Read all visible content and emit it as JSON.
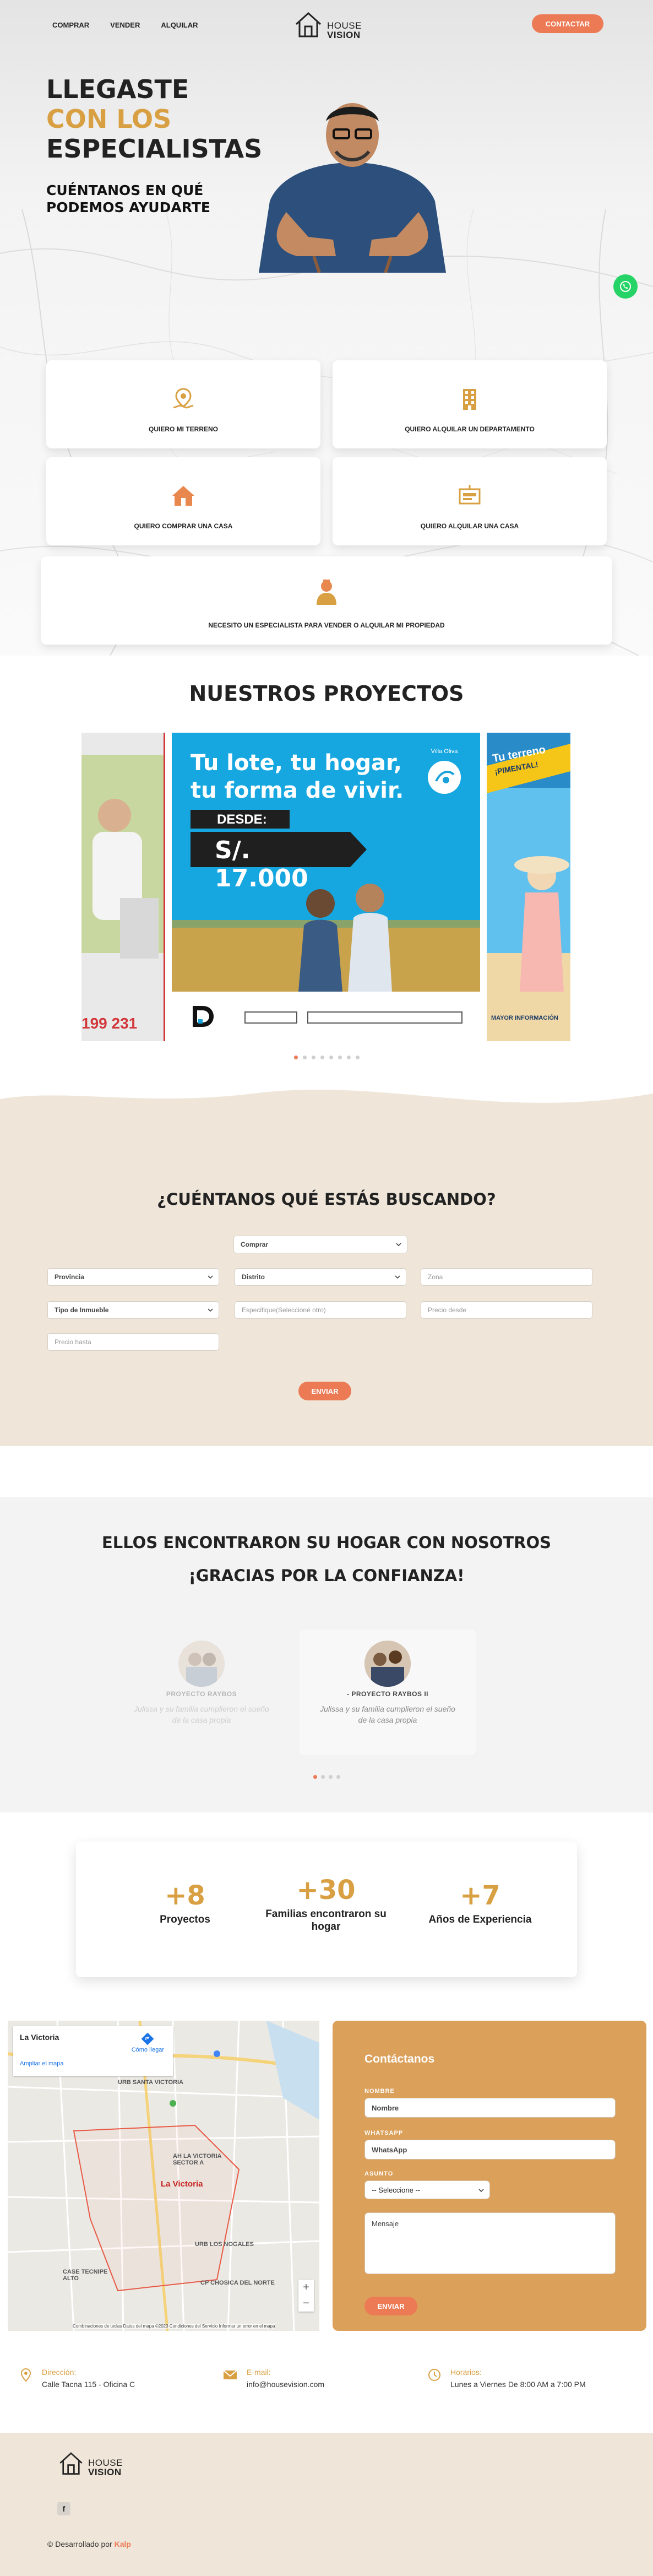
{
  "nav": {
    "links": [
      "COMPRAR",
      "VENDER",
      "ALQUILAR"
    ],
    "logo_line1": "HOUSE",
    "logo_line2": "VISION",
    "contact_label": "CONTACTAR"
  },
  "hero": {
    "line1": "LLEGASTE",
    "line2": "CON LOS",
    "line3": "ESPECIALISTAS",
    "subtitle": "CUÉNTANOS EN QUÉ PODEMOS AYUDARTE"
  },
  "options": [
    {
      "label": "QUIERO MI TERRENO",
      "icon": "map-pin-icon"
    },
    {
      "label": "QUIERO ALQUILAR UN DEPARTAMENTO",
      "icon": "building-icon"
    },
    {
      "label": "QUIERO COMPRAR UNA CASA",
      "icon": "house-icon"
    },
    {
      "label": "QUIERO ALQUILAR UNA CASA",
      "icon": "for-rent-sign-icon"
    },
    {
      "label": "NECESITO UN ESPECIALISTA PARA VENDER O ALQUILAR MI PROPIEDAD",
      "icon": "specialist-icon"
    }
  ],
  "projects": {
    "title": "NUESTROS PROYECTOS",
    "main_slide": {
      "headline1": "Tu lote, tu hogar,",
      "headline2": "tu forma de vivir.",
      "desde": "DESDE:",
      "price": "S/. 17.000",
      "brand": "Villa Oliva"
    },
    "left_slide_number": "199 231",
    "right_slide_text1": "Tu terreno",
    "right_slide_text2": "¡PIMENTAL!",
    "right_slide_footer": "MAYOR INFORMACIÓN"
  },
  "search": {
    "title": "¿CUÉNTANOS QUÉ ESTÁS BUSCANDO?",
    "operation": "Comprar",
    "provincia": "Provincia",
    "distrito": "Distrito",
    "zona": "Zona",
    "tipo": "Tipo de Inmueble",
    "especifique": "Especifique(Seleccioné otro)",
    "precio_desde": "Precio desde",
    "precio_hasta": "Precio hasta",
    "send": "ENVIAR"
  },
  "testimonials": {
    "title": "ELLOS ENCONTRARON SU HOGAR CON NOSOTROS",
    "subtitle": "¡GRACIAS POR LA CONFIANZA!",
    "items": [
      {
        "name": "PROYECTO RAYBOS",
        "quote": "Julissa y su familia cumplieron el sueño de la casa propia"
      },
      {
        "name": "- PROYECTO RAYBOS II",
        "quote": "Julissa y su familia cumplieron el sueño de la casa propia"
      }
    ]
  },
  "stats": [
    {
      "num": "+8",
      "label": "Proyectos"
    },
    {
      "num": "+30",
      "label": "Familias encontraron su hogar"
    },
    {
      "num": "+7",
      "label": "Años de Experiencia"
    }
  ],
  "map": {
    "place": "La Victoria",
    "place_sub": "Ampliar el mapa",
    "directions": "Cómo llegar",
    "district_label": "La Victoria",
    "labels": [
      "URB SANTA VICTORIA",
      "AH LA VICTORIA SECTOR A",
      "CP CHOSICA DEL NORTE",
      "URB LOS NOGALES",
      "CASE TECNIPE ALTO"
    ],
    "footer": "Combinaciones de teclas   Datos del mapa ©2023   Condiciones del Servicio   Informar un error en el mapa"
  },
  "contact": {
    "title": "Contáctanos",
    "nombre_label": "NOMBRE",
    "nombre_ph": "Nombre",
    "whatsapp_label": "WHATSAPP",
    "whatsapp_ph": "WhatsApp",
    "asunto_label": "ASUNTO",
    "asunto_value": "-- Seleccione --",
    "mensaje_ph": "Mensaje",
    "send": "ENVIAR"
  },
  "info": [
    {
      "t1": "Dirección:",
      "t2": "Calle Tacna 115 - Oficina C"
    },
    {
      "t1": "E-mail:",
      "t2": "info@housevision.com"
    },
    {
      "t1": "Horarios:",
      "t2": "Lunes a Viernes De 8:00 AM a 7:00 PM"
    }
  ],
  "footer": {
    "logo_line1": "HOUSE",
    "logo_line2": "VISION",
    "fb": "f",
    "credit_prefix": "© Desarrollado por",
    "credit_brand": "Kalp"
  },
  "colors": {
    "accent": "#ec7a55",
    "gold": "#d9a043",
    "beige": "#efe6d9",
    "contact": "#dba05a"
  }
}
